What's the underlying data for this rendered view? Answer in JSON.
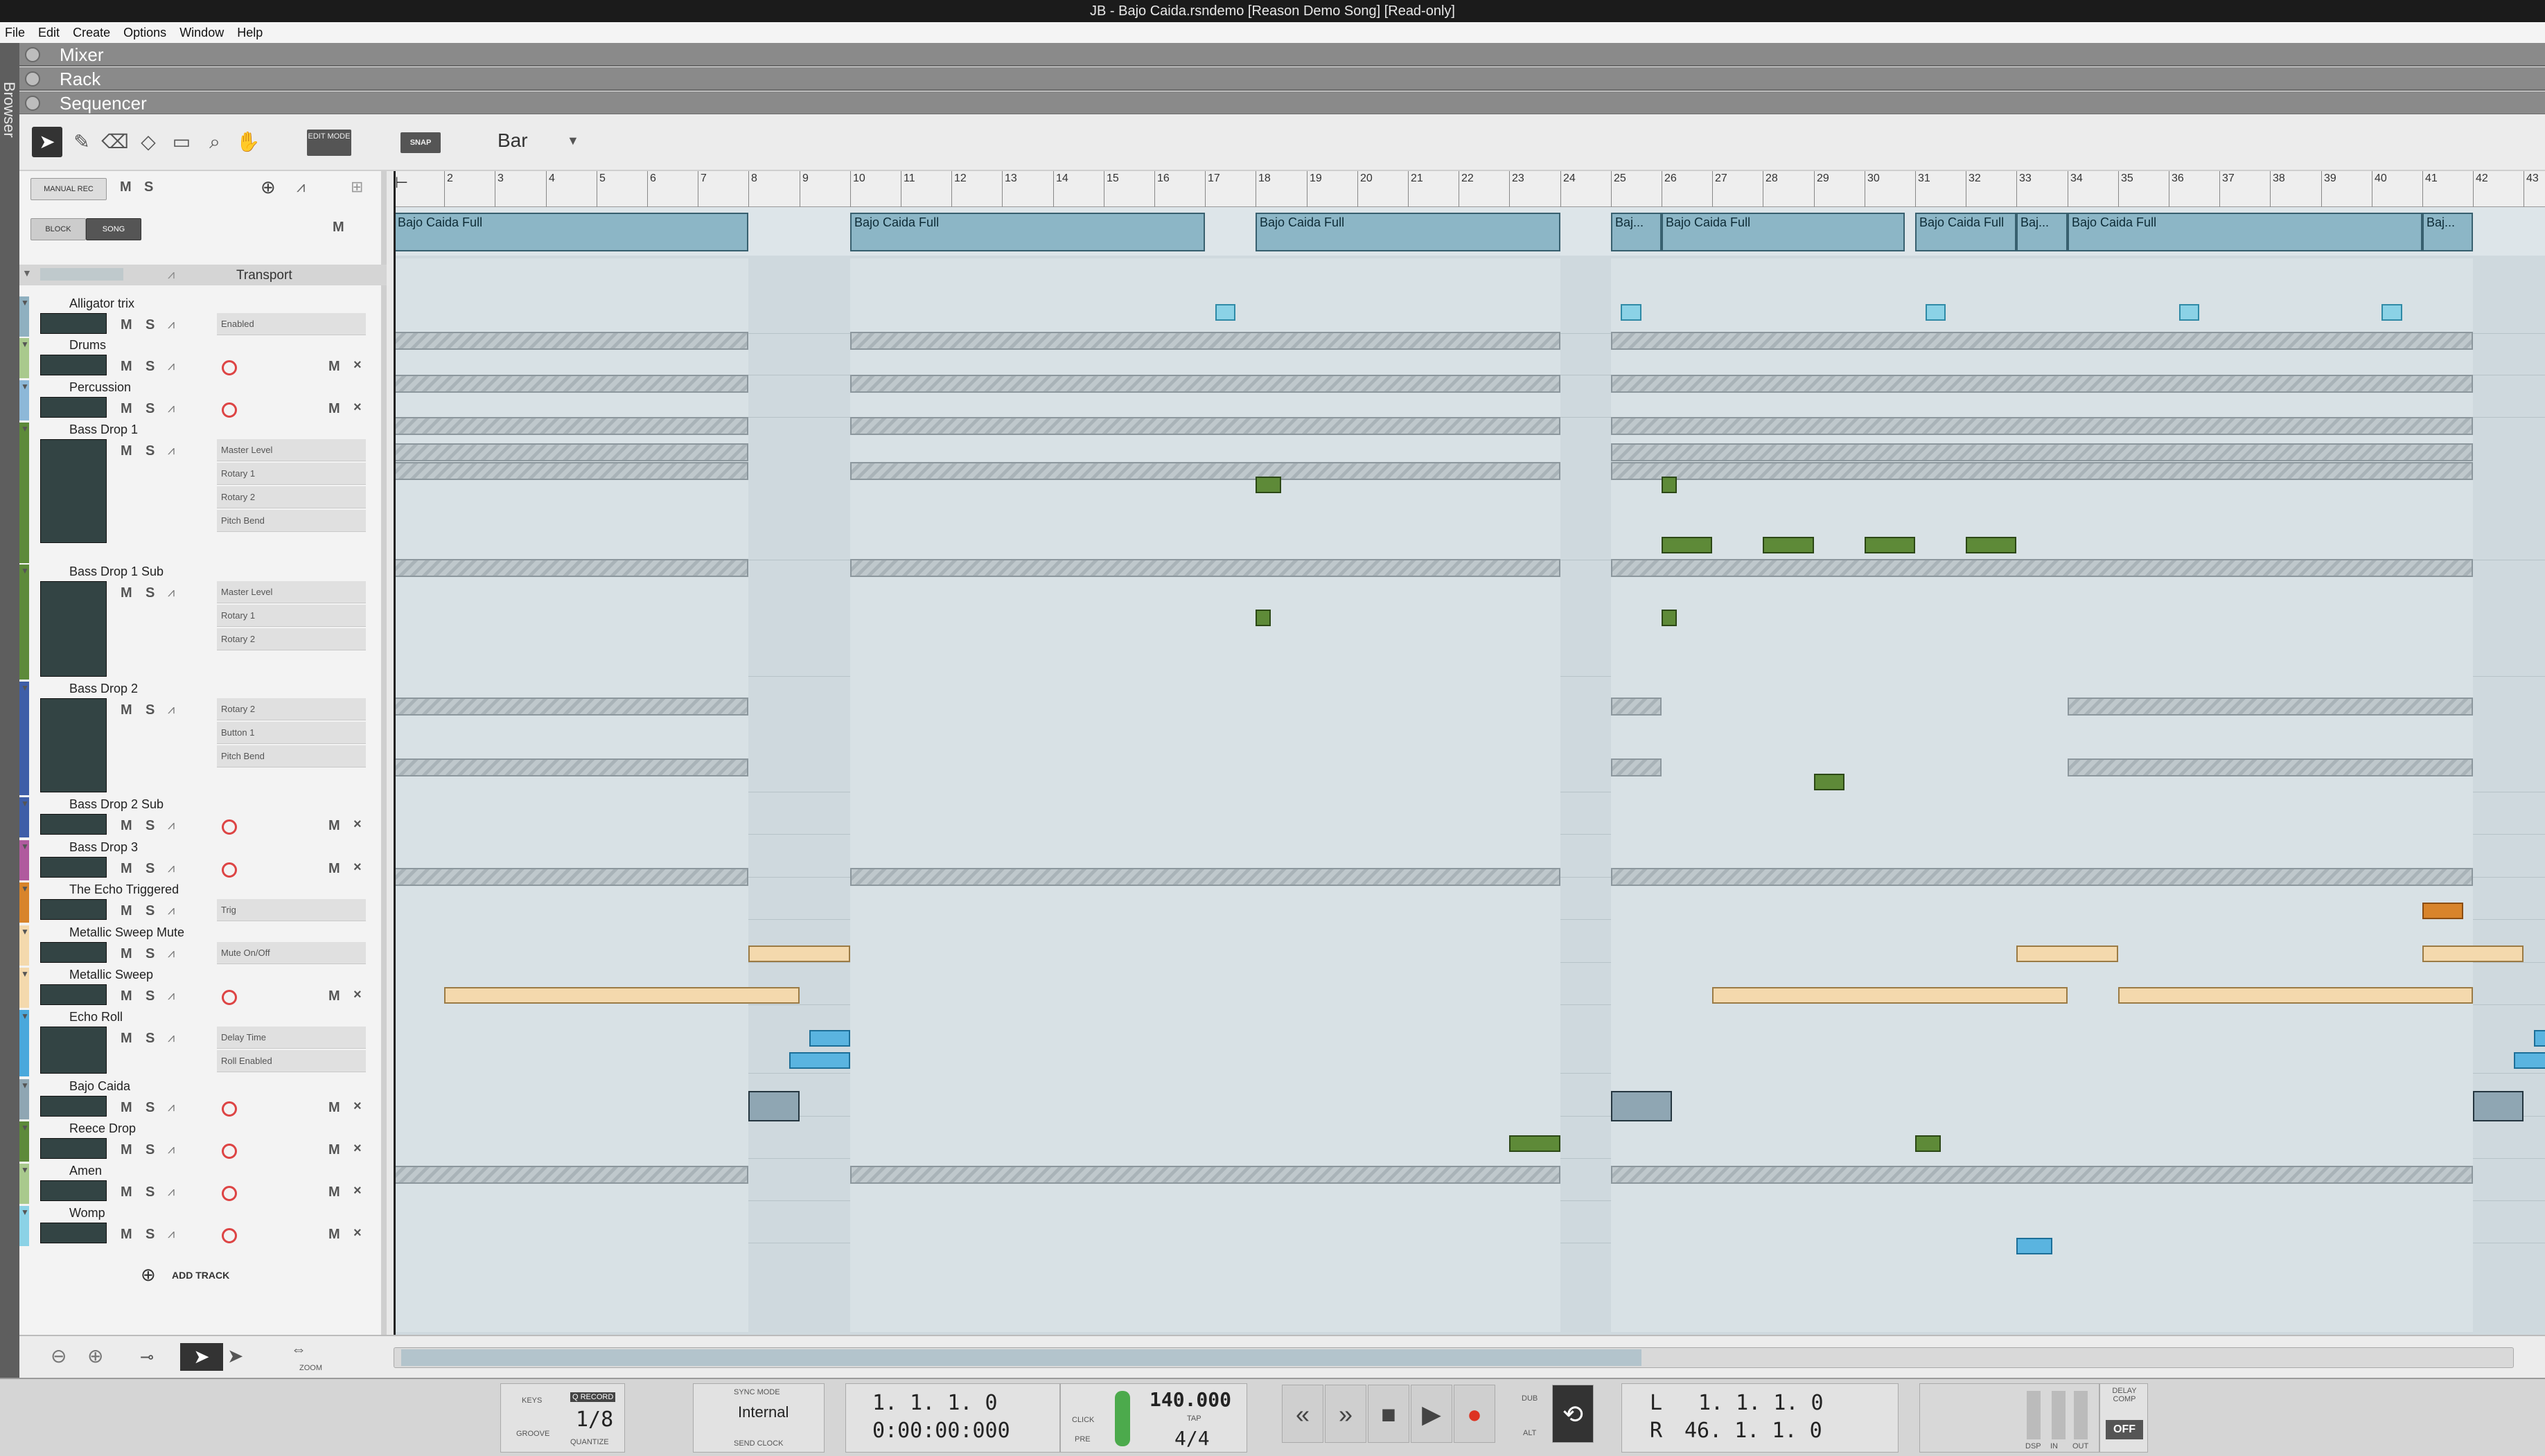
{
  "window": {
    "title": "JB - Bajo Caida.rsndemo [Reason Demo Song] [Read-only]"
  },
  "menu": [
    "File",
    "Edit",
    "Create",
    "Options",
    "Window",
    "Help"
  ],
  "browser_label": "Browser",
  "sections": {
    "mixer": "Mixer",
    "rack": "Rack",
    "sequencer": "Sequencer"
  },
  "toolbar": {
    "edit_mode": "EDIT MODE",
    "snap": "SNAP",
    "snap_value": "Bar"
  },
  "left_panel": {
    "manual_rec": "MANUAL REC",
    "block": "BLOCK",
    "song": "SONG",
    "m": "M",
    "s": "S",
    "transport_label": "Transport",
    "add_track": "ADD TRACK"
  },
  "ruler": [
    "2",
    "3",
    "4",
    "5",
    "6",
    "7",
    "8",
    "9",
    "10",
    "11",
    "12",
    "13",
    "14",
    "15",
    "16",
    "17",
    "18",
    "19",
    "20",
    "21",
    "22",
    "23",
    "24",
    "25",
    "26",
    "27",
    "28",
    "29",
    "30",
    "31",
    "32",
    "33",
    "34",
    "35",
    "36",
    "37",
    "38",
    "39",
    "40",
    "41",
    "42",
    "43"
  ],
  "blocks": [
    {
      "label": "Bajo Caida Full"
    },
    {
      "label": "Bajo Caida Full"
    },
    {
      "label": "Bajo Caida Full"
    },
    {
      "label": "Baj..."
    },
    {
      "label": "Bajo Caida Full"
    },
    {
      "label": "Bajo Caida Full"
    },
    {
      "label": "Baj..."
    },
    {
      "label": "Bajo Caida Full"
    },
    {
      "label": "Baj..."
    }
  ],
  "tracks": [
    {
      "name": "Alligator trix",
      "color": "#8fb0c0",
      "subs": [
        "Enabled"
      ]
    },
    {
      "name": "Drums",
      "color": "#a9c98d",
      "subs": []
    },
    {
      "name": "Percussion",
      "color": "#8db8d8",
      "subs": []
    },
    {
      "name": "Bass Drop 1",
      "color": "#5d8a3a",
      "subs": [
        "Master Level",
        "Rotary 1",
        "Rotary 2",
        "Pitch Bend"
      ]
    },
    {
      "name": "Bass Drop 1 Sub",
      "color": "#5d8a3a",
      "subs": [
        "Master Level",
        "Rotary 1",
        "Rotary 2"
      ]
    },
    {
      "name": "Bass Drop 2",
      "color": "#3e5ea8",
      "subs": [
        "Rotary 2",
        "Button 1",
        "Pitch Bend"
      ]
    },
    {
      "name": "Bass Drop 2 Sub",
      "color": "#3e5ea8",
      "subs": []
    },
    {
      "name": "Bass Drop 3",
      "color": "#b05a9e",
      "subs": []
    },
    {
      "name": "The Echo Triggered",
      "color": "#d8842b",
      "subs": [
        "Trig"
      ]
    },
    {
      "name": "Metallic Sweep Mute",
      "color": "#f4d9ad",
      "subs": [
        "Mute On/Off"
      ]
    },
    {
      "name": "Metallic Sweep",
      "color": "#f4d9ad",
      "subs": []
    },
    {
      "name": "Echo Roll",
      "color": "#4aa8dc",
      "subs": [
        "Delay Time",
        "Roll Enabled"
      ]
    },
    {
      "name": "Bajo Caida",
      "color": "#8fa6b3",
      "subs": []
    },
    {
      "name": "Reece Drop",
      "color": "#5d8a3a",
      "subs": []
    },
    {
      "name": "Amen",
      "color": "#a9c98d",
      "subs": []
    },
    {
      "name": "Womp",
      "color": "#8bd2e6",
      "subs": []
    }
  ],
  "bottom_nav": {
    "zoom": "ZOOM"
  },
  "transport": {
    "keys": "KEYS",
    "groove": "GROOVE",
    "q_record": "Q RECORD",
    "quantize_value": "1/8",
    "quantize": "QUANTIZE",
    "sync_mode": "SYNC MODE",
    "sync_value": "Internal",
    "send_clock": "SEND CLOCK",
    "position_bars": "1.  1.  1.    0",
    "position_time": "0:00:00:000",
    "click": "CLICK",
    "pre": "PRE",
    "tempo": "140.000",
    "tap": "TAP",
    "signature": "4/4",
    "dub": "DUB",
    "alt": "ALT",
    "loop_left_label": "L",
    "loop_right_label": "R",
    "loop_left": "1.  1.  1.    0",
    "loop_right": "46.  1.  1.    0",
    "dsp": "DSP",
    "in": "IN",
    "out": "OUT",
    "delay_comp": "DELAY COMP",
    "off": "OFF"
  }
}
